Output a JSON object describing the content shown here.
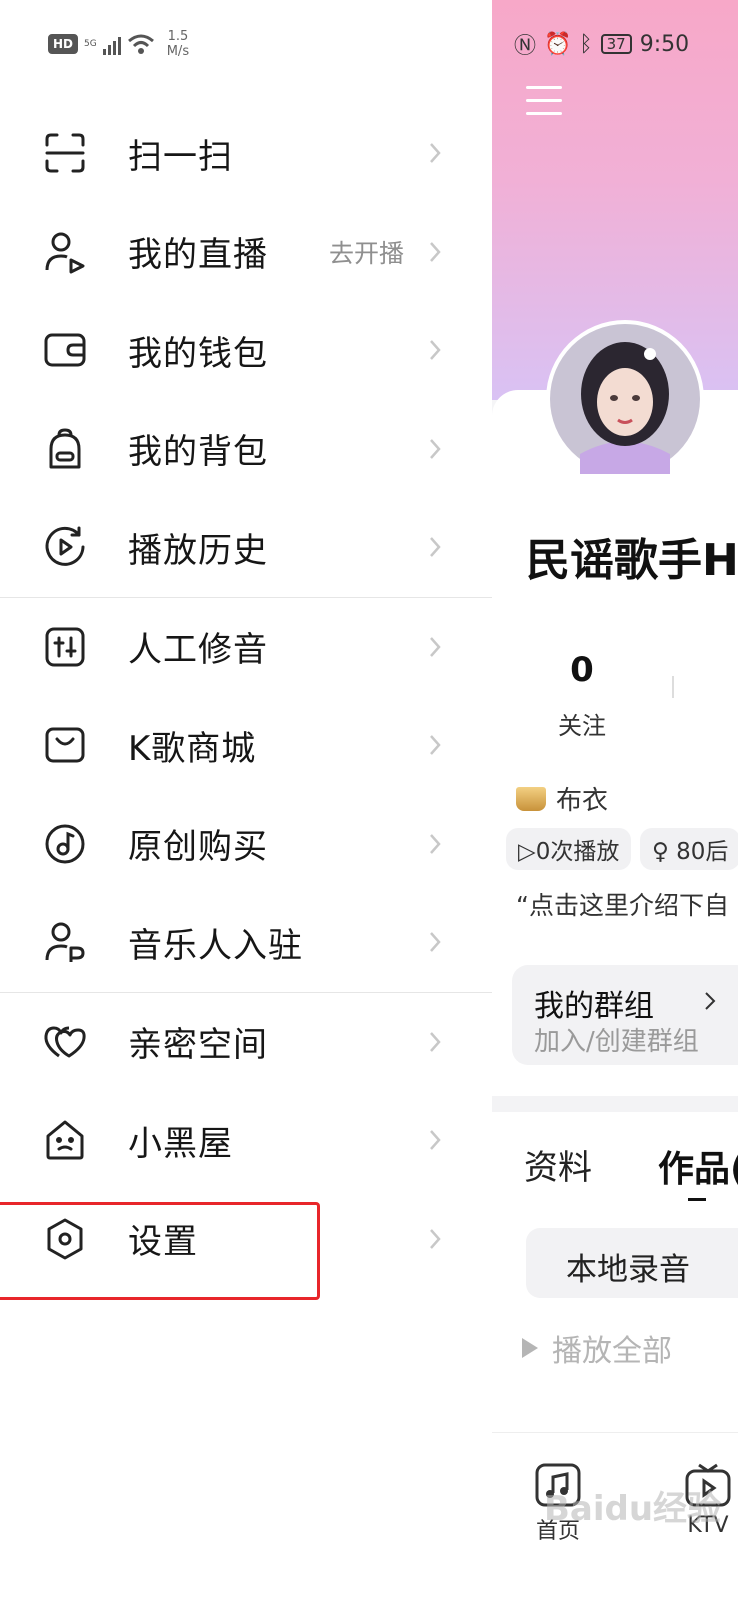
{
  "status_left": {
    "network": "5G",
    "speed_value": "1.5",
    "speed_unit": "M/s",
    "hd_label": "HD"
  },
  "status_right": {
    "battery": "37",
    "time": "9:50"
  },
  "menu": {
    "items": [
      {
        "label": "扫一扫",
        "icon": "scan-icon"
      },
      {
        "label": "我的直播",
        "icon": "live-icon",
        "extra": "去开播"
      },
      {
        "label": "我的钱包",
        "icon": "wallet-icon"
      },
      {
        "label": "我的背包",
        "icon": "backpack-icon"
      },
      {
        "label": "播放历史",
        "icon": "history-icon"
      },
      {
        "label": "人工修音",
        "icon": "tuning-icon"
      },
      {
        "label": "K歌商城",
        "icon": "shop-bag-icon"
      },
      {
        "label": "原创购买",
        "icon": "music-disc-icon"
      },
      {
        "label": "音乐人入驻",
        "icon": "musician-icon"
      },
      {
        "label": "亲密空间",
        "icon": "hearts-icon"
      },
      {
        "label": "小黑屋",
        "icon": "house-face-icon"
      },
      {
        "label": "设置",
        "icon": "settings-icon"
      }
    ]
  },
  "highlight_color": "#e8262a",
  "profile": {
    "name": "民谣歌手H",
    "follow_count": "0",
    "follow_label": "关注",
    "rank": "布衣",
    "plays_chip": "▷0次播放",
    "age_chip": "♀ 80后",
    "intro": "“点击这里介绍下自",
    "group_title": "我的群组",
    "group_sub": "加入/创建群组",
    "tab_info": "资料",
    "tab_works": "作品(",
    "local_record": "本地录音",
    "play_all": "播放全部"
  },
  "nav": {
    "home": "首页",
    "ktv": "KTV"
  },
  "watermark": "Baidu经验"
}
